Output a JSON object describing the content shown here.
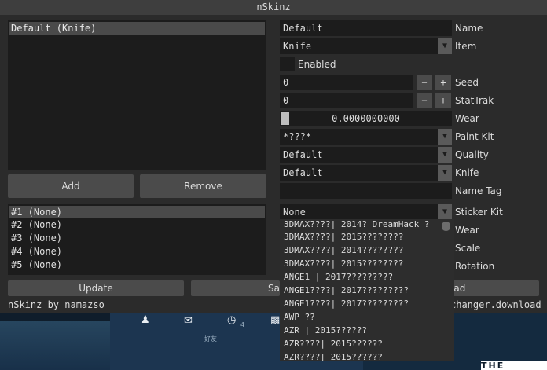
{
  "window": {
    "title": "nSkinz"
  },
  "skins_list": {
    "items": [
      "Default (Knife)"
    ]
  },
  "buttons": {
    "add": "Add",
    "remove": "Remove",
    "update": "Update",
    "save": "Sa",
    "load": "oad"
  },
  "fields": {
    "name": {
      "value": "Default",
      "label": "Name"
    },
    "item": {
      "value": "Knife",
      "label": "Item"
    },
    "enabled": {
      "label": "Enabled"
    },
    "seed": {
      "value": "0",
      "label": "Seed"
    },
    "stattrak": {
      "value": "0",
      "label": "StatTrak"
    },
    "wear": {
      "value": "0.0000000000",
      "label": "Wear"
    },
    "paint_kit": {
      "value": "*???*",
      "label": "Paint Kit"
    },
    "quality": {
      "value": "Default",
      "label": "Quality"
    },
    "knife": {
      "value": "Default",
      "label": "Knife"
    },
    "name_tag": {
      "value": "",
      "label": "Name Tag"
    },
    "sticker_kit": {
      "value": "None",
      "label": "Sticker Kit"
    },
    "sticker_wear": {
      "label": "Wear"
    },
    "sticker_scale": {
      "label": "Scale"
    },
    "sticker_rotation": {
      "label": "Rotation"
    }
  },
  "sticker_slots": [
    "#1 (None)",
    "#2 (None)",
    "#3 (None)",
    "#4 (None)",
    "#5 (None)"
  ],
  "sticker_dropdown": [
    "3DMAX????| 2014? DreamHack ?",
    "3DMAX????| 2015????????",
    "3DMAX????| 2014????????",
    "3DMAX????| 2015????????",
    "ANGE1 | 2017?????????",
    "ANGE1????| 2017?????????",
    "ANGE1????| 2017?????????",
    "AWP ??",
    "AZR | 2015??????",
    "AZR????| 2015??????",
    "AZR????| 2015??????"
  ],
  "footer": {
    "left": "nSkinz by namazso",
    "right": "changer.download"
  },
  "background": {
    "taskbar_text": "好友",
    "badge": "4",
    "banner_text": "THE"
  },
  "icons": [
    "user-icon",
    "mail-icon",
    "history-icon",
    "gift-icon",
    "dropdown-arrow-icon"
  ]
}
